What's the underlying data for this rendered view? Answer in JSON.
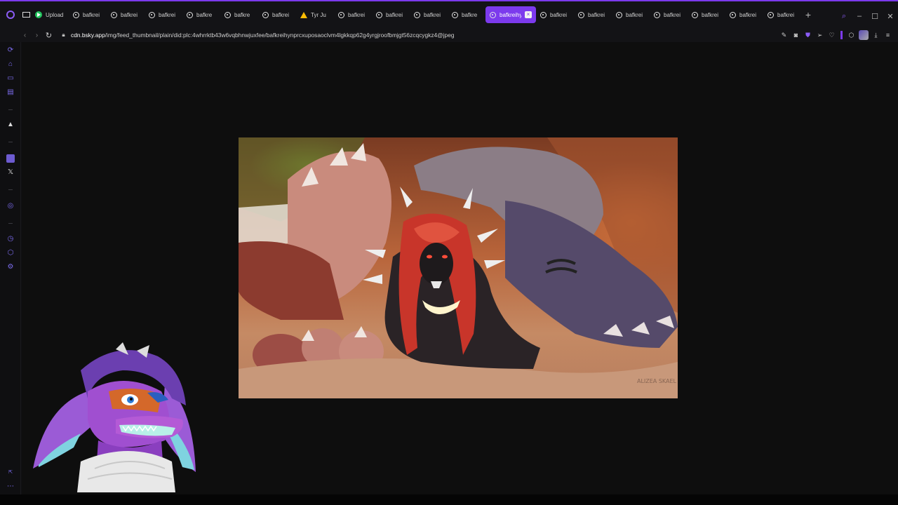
{
  "browser": {
    "tabs": [
      {
        "label": "Upload",
        "favicon": "upload-favicon",
        "active": false
      },
      {
        "label": "bafkrei",
        "favicon": "globe-favicon",
        "active": false
      },
      {
        "label": "bafkrei",
        "favicon": "globe-favicon",
        "active": false
      },
      {
        "label": "bafkrei",
        "favicon": "globe-favicon",
        "active": false
      },
      {
        "label": "bafkre",
        "favicon": "globe-favicon",
        "active": false
      },
      {
        "label": "bafkre",
        "favicon": "globe-favicon",
        "active": false
      },
      {
        "label": "bafkrei",
        "favicon": "globe-favicon",
        "active": false
      },
      {
        "label": "Tyr Ju",
        "favicon": "drive-favicon",
        "active": false
      },
      {
        "label": "bafkrei",
        "favicon": "globe-favicon",
        "active": false
      },
      {
        "label": "bafkrei",
        "favicon": "globe-favicon",
        "active": false
      },
      {
        "label": "bafkrei",
        "favicon": "globe-favicon",
        "active": false
      },
      {
        "label": "bafkre",
        "favicon": "globe-favicon",
        "active": false
      },
      {
        "label": "bafkreihy",
        "favicon": "globe-favicon",
        "active": true
      },
      {
        "label": "bafkrei",
        "favicon": "globe-favicon",
        "active": false
      },
      {
        "label": "bafkrei",
        "favicon": "globe-favicon",
        "active": false
      },
      {
        "label": "bafkrei",
        "favicon": "globe-favicon",
        "active": false
      },
      {
        "label": "bafkrei",
        "favicon": "globe-favicon",
        "active": false
      },
      {
        "label": "bafkrei",
        "favicon": "globe-favicon",
        "active": false
      },
      {
        "label": "bafkrei",
        "favicon": "globe-favicon",
        "active": false
      },
      {
        "label": "bafkrei",
        "favicon": "globe-favicon",
        "active": false
      }
    ],
    "url_host": "cdn.bsky.app",
    "url_path": "/img/feed_thumbnail/plain/did:plc:4whrrktb43w6vqbhnwjuxfee/bafkreihynprcxuposaoclvm4lgkkqp62g4yrgjroofbmjgt56zcqcygkz4@jpeg",
    "accent_color": "#7c3aed"
  },
  "image": {
    "watermark": "ALIZEA SKAEL"
  }
}
